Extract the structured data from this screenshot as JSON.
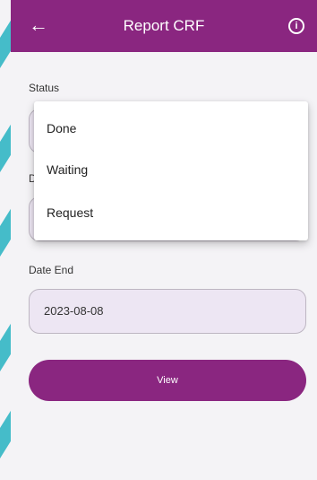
{
  "appbar": {
    "title": "Report CRF",
    "back_icon": "arrow-left-icon",
    "info_icon": "info-icon",
    "color": "#8a2680"
  },
  "form": {
    "status_label": "Status",
    "date_start_label_partial": "D",
    "date_end_label": "Date End",
    "date_end_value": "2023-08-08",
    "view_button": "View"
  },
  "dropdown": {
    "options": [
      "Done",
      "Waiting",
      "Request"
    ]
  },
  "colors": {
    "primary": "#8a2680",
    "field_bg": "#ede6f3",
    "accent_deco": "#3bb8c6"
  }
}
